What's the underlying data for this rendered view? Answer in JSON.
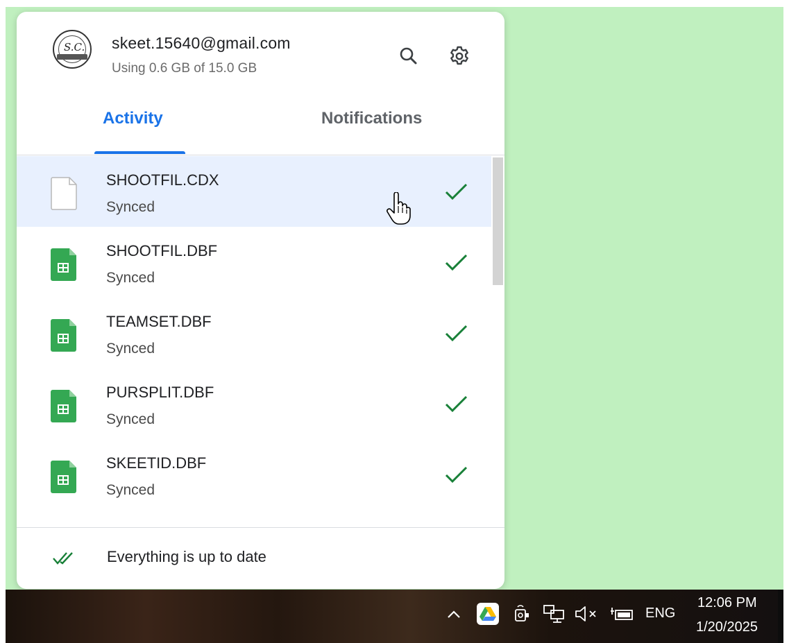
{
  "account": {
    "email": "skeet.15640@gmail.com",
    "storage": "Using 0.6 GB of 15.0 GB",
    "avatar_icon": "club-logo-avatar"
  },
  "header_actions": {
    "search_icon": "search-icon",
    "settings_icon": "gear-icon"
  },
  "tabs": [
    {
      "label": "Activity",
      "selected": true
    },
    {
      "label": "Notifications",
      "selected": false
    }
  ],
  "files": [
    {
      "name": "SHOOTFIL.CDX",
      "status": "Synced",
      "type": "generic-file",
      "hovered": true
    },
    {
      "name": "SHOOTFIL.DBF",
      "status": "Synced",
      "type": "spreadsheet",
      "hovered": false
    },
    {
      "name": "TEAMSET.DBF",
      "status": "Synced",
      "type": "spreadsheet",
      "hovered": false
    },
    {
      "name": "PURSPLIT.DBF",
      "status": "Synced",
      "type": "spreadsheet",
      "hovered": false
    },
    {
      "name": "SKEETID.DBF",
      "status": "Synced",
      "type": "spreadsheet",
      "hovered": false
    }
  ],
  "footer": {
    "status": "Everything is up to date",
    "icon": "double-check-icon"
  },
  "taskbar": {
    "language": "ENG",
    "time": "12:06 PM",
    "date": "1/20/2025"
  },
  "colors": {
    "accent": "#1a73e8",
    "check_green": "#188038",
    "sheet_green": "#34a853",
    "hover_row": "#e8f0fe",
    "desktop_green": "#c0f0bf"
  }
}
